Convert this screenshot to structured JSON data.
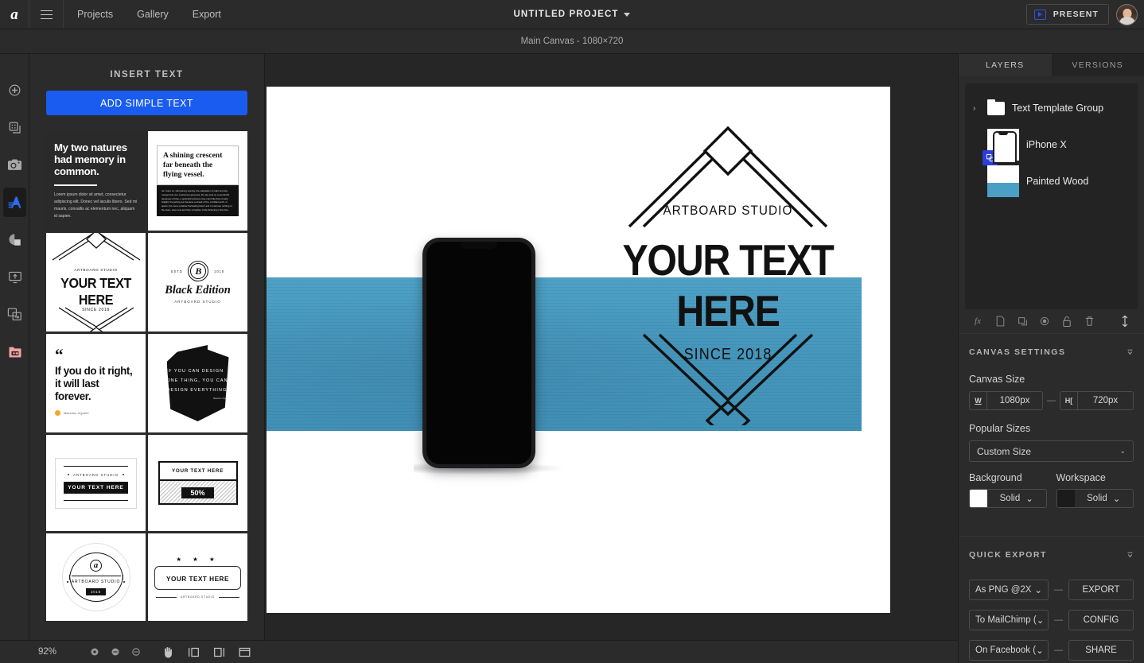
{
  "topbar": {
    "logo": "artboard-logo",
    "menu_icon": "hamburger-icon",
    "nav": [
      {
        "label": "Projects"
      },
      {
        "label": "Gallery"
      },
      {
        "label": "Export"
      }
    ],
    "project_title": "UNTITLED PROJECT",
    "present_label": "PRESENT",
    "present_icon": "play-video-icon",
    "avatar": "user-avatar"
  },
  "subbar": {
    "canvas_label": "Main Canvas - 1080×720"
  },
  "rail": {
    "items": [
      {
        "name": "add-element",
        "icon": "plus-circle-icon",
        "active": false
      },
      {
        "name": "templates",
        "icon": "grid-copy-icon",
        "active": false
      },
      {
        "name": "mockups",
        "icon": "camera-icon",
        "active": false
      },
      {
        "name": "text",
        "icon": "letter-a-icon",
        "active": true
      },
      {
        "name": "shapes",
        "icon": "pie-shape-icon",
        "active": false
      },
      {
        "name": "upload",
        "icon": "monitor-upload-icon",
        "active": false
      },
      {
        "name": "replace",
        "icon": "swap-frames-icon",
        "active": false
      },
      {
        "name": "assets",
        "icon": "media-folder-icon",
        "active": false
      }
    ]
  },
  "panel": {
    "title": "INSERT TEXT",
    "add_button": "ADD SIMPLE TEXT",
    "templates": [
      {
        "id": "tpl-quote-dark",
        "heading": "My two natures had memory in common.",
        "body": "Lorem ipsum dolor sit amet, consectetur adipiscing elit. Donec vel iaculis libero. Sed mi mauris, convallis ac elementum nec, aliquam id sapien."
      },
      {
        "id": "tpl-crescent",
        "heading": "A shining crescent far beneath the flying vessel.",
        "body": "As I went on, still gaining velocity, the palpitation of night and day merged into one continuous greyness; the sky took on a wonderful deepness of blue, a splendid luminous tone color like that of early twilight; the jerking sun became a streak of fire, a brilliant arch, in space; the moon a fainter fluctuating band; and I could see nothing of the stars, save now and then a brighter circle flickering in the blue."
      },
      {
        "id": "tpl-mountain-badge",
        "brand": "ARTBOARD STUDIO",
        "heading": "YOUR TEXT HERE",
        "since": "SINCE 2018"
      },
      {
        "id": "tpl-black-edition",
        "monogram": "B",
        "estd": "ESTD",
        "year": "2018",
        "heading": "Black Edition",
        "brand": "ARTBOARD STUDIO"
      },
      {
        "id": "tpl-forever-quote",
        "quote_mark": "“",
        "heading": "If you do it right, it will last forever.",
        "author": "Massimo Vignelli"
      },
      {
        "id": "tpl-design-everything",
        "heading": "IF YOU CAN DESIGN ONE THING, YOU CAN DESIGN EVERYTHING",
        "author": "Massimo Vignelli"
      },
      {
        "id": "tpl-classic-label",
        "brand": "ARTBOARD STUDIO",
        "heading": "YOUR TEXT HERE"
      },
      {
        "id": "tpl-percent-tag",
        "heading": "YOUR TEXT HERE",
        "value": "50%"
      },
      {
        "id": "tpl-circle-seal",
        "monogram": "a",
        "brand": "ARTBOARD STUDIO",
        "year": "2018"
      },
      {
        "id": "tpl-stars-plaque",
        "stars": "★ ★ ★",
        "heading": "YOUR TEXT HERE",
        "brand": "ARTBOARD STUDIO"
      }
    ]
  },
  "canvas": {
    "design": {
      "brand": "ARTBOARD STUDIO",
      "headline": "YOUR TEXT HERE",
      "since": "SINCE 2018"
    },
    "band_color": "#4496bd",
    "background_color": "#ffffff"
  },
  "chat": {
    "icon": "intercom-chat-icon"
  },
  "right_panel": {
    "tabs": [
      {
        "label": "LAYERS",
        "active": true
      },
      {
        "label": "VERSIONS",
        "active": false
      }
    ],
    "layers": [
      {
        "name": "Text Template Group",
        "type": "folder",
        "expandable": true,
        "chevron": "›"
      },
      {
        "name": "iPhone X",
        "type": "mockup",
        "linked": true
      },
      {
        "name": "Painted Wood",
        "type": "image"
      }
    ],
    "layer_tools": [
      {
        "name": "effects",
        "icon": "fx-icon",
        "glyph": "fx"
      },
      {
        "name": "new-layer",
        "icon": "page-icon"
      },
      {
        "name": "duplicate",
        "icon": "duplicate-icon"
      },
      {
        "name": "visibility",
        "icon": "eye-icon"
      },
      {
        "name": "lock",
        "icon": "lock-icon"
      },
      {
        "name": "delete",
        "icon": "trash-icon"
      },
      {
        "name": "reorder",
        "icon": "sort-arrows-icon"
      }
    ],
    "canvas_settings": {
      "title": "CANVAS SETTINGS",
      "canvas_size_label": "Canvas Size",
      "width_prefix": "W",
      "width_value": "1080px",
      "height_prefix": "H",
      "height_value": "720px",
      "popular_sizes_label": "Popular Sizes",
      "popular_sizes_value": "Custom Size",
      "background_label": "Background",
      "background_value": "Solid",
      "background_color": "#ffffff",
      "workspace_label": "Workspace",
      "workspace_value": "Solid",
      "workspace_color": "#1b1b1b"
    },
    "quick_export": {
      "title": "QUICK EXPORT",
      "rows": [
        {
          "select": "As PNG @2X",
          "button": "EXPORT"
        },
        {
          "select": "To MailChimp (",
          "button": "CONFIG"
        },
        {
          "select": "On Facebook (",
          "button": "SHARE"
        }
      ]
    }
  },
  "bottombar": {
    "zoom": "92%",
    "tools": [
      {
        "name": "zoom-fit",
        "icon": "zoom-fit-icon"
      },
      {
        "name": "zoom-out",
        "icon": "zoom-out-icon"
      },
      {
        "name": "zoom-in",
        "icon": "zoom-in-icon"
      },
      {
        "name": "hand-tool",
        "icon": "hand-icon"
      },
      {
        "name": "align-left-panel",
        "icon": "panel-left-icon"
      },
      {
        "name": "align-right-panel",
        "icon": "panel-right-icon"
      },
      {
        "name": "fit-screen",
        "icon": "fit-screen-icon"
      }
    ]
  }
}
